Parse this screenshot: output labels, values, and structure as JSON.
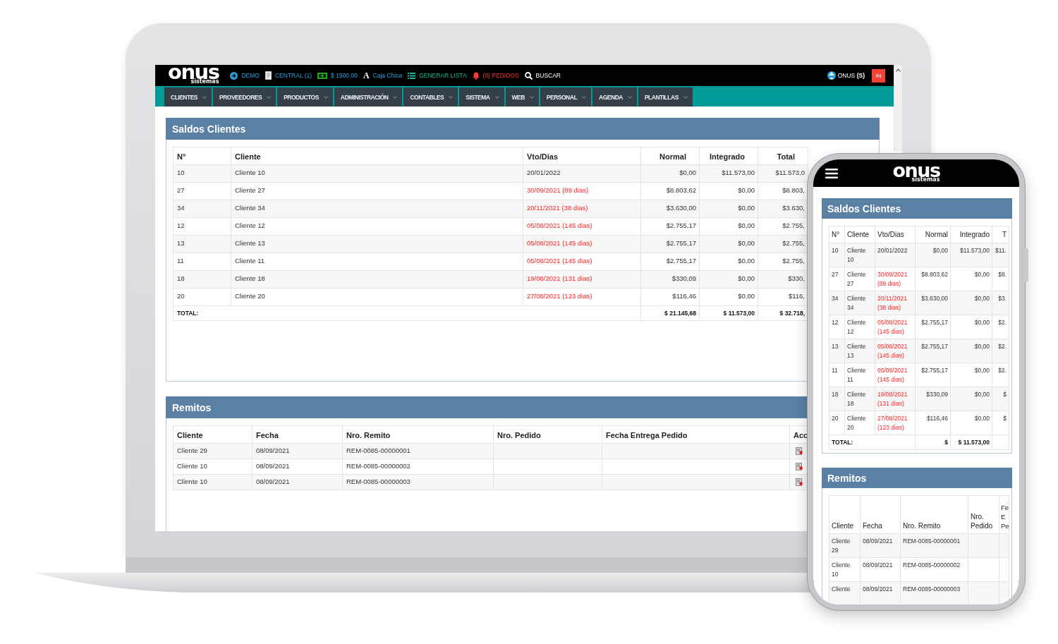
{
  "laptop": {
    "topbar": {
      "logo": {
        "wordmark": "onus",
        "tagline": "sistemas"
      },
      "links": [
        {
          "kind": "demo",
          "label": "DEMO"
        },
        {
          "kind": "branch",
          "label": "CENTRAL (1)"
        },
        {
          "kind": "cash",
          "label": "$ 1500.00"
        },
        {
          "kind": "register",
          "icon": "A",
          "label": "Caja Chica"
        },
        {
          "kind": "list",
          "label": "GENERAR LISTA"
        },
        {
          "kind": "orders",
          "label": "(0) PEDIDOS"
        },
        {
          "kind": "search",
          "label": "BUSCAR"
        }
      ],
      "user": "ONUS **(S)**",
      "badge": "IN"
    },
    "nav": [
      "CLIENTES",
      "PROVEEDORES",
      "PRODUCTOS",
      "ADMINISTRACIÓN",
      "CONTABLES",
      "SISTEMA",
      "WEB",
      "PERSONAL",
      "AGENDA",
      "PLANTILLAS"
    ],
    "panels": [
      {
        "title": "Saldos Clientes",
        "columns": [
          {
            "label": "N°",
            "kind": "text"
          },
          {
            "label": "Cliente",
            "kind": "text"
          },
          {
            "label": "Vto/Dias",
            "kind": "due"
          },
          {
            "label": "Normal",
            "kind": "amount"
          },
          {
            "label": "Integrado",
            "kind": "amount"
          },
          {
            "label": "Total",
            "kind": "amount"
          }
        ],
        "rows": [
          {
            "cells": [
              "10",
              "Cliente 10",
              "20/01/2022",
              "$0,00",
              "$11.573,00",
              "$11.573,0"
            ],
            "overdue": false
          },
          {
            "cells": [
              "27",
              "Cliente 27",
              "30/09/2021 (89 dias)",
              "$8.803,62",
              "$0,00",
              "$8.803,"
            ],
            "overdue": true
          },
          {
            "cells": [
              "34",
              "Cliente 34",
              "20/11/2021 (38 dias)",
              "$3.630,00",
              "$0,00",
              "$3.630,"
            ],
            "overdue": true
          },
          {
            "cells": [
              "12",
              "Cliente 12",
              "05/08/2021 (145 dias)",
              "$2.755,17",
              "$0,00",
              "$2.755,"
            ],
            "overdue": true
          },
          {
            "cells": [
              "13",
              "Cliente 13",
              "05/08/2021 (145 dias)",
              "$2.755,17",
              "$0,00",
              "$2.755,"
            ],
            "overdue": true
          },
          {
            "cells": [
              "11",
              "Cliente 11",
              "05/08/2021 (145 dias)",
              "$2.755,17",
              "$0,00",
              "$2.755,"
            ],
            "overdue": true
          },
          {
            "cells": [
              "18",
              "Cliente 18",
              "19/08/2021 (131 dias)",
              "$330,09",
              "$0,00",
              "$330,"
            ],
            "overdue": true
          },
          {
            "cells": [
              "20",
              "Cliente 20",
              "27/08/2021 (123 dias)",
              "$116,46",
              "$0,00",
              "$116,"
            ],
            "overdue": true
          }
        ],
        "total": {
          "label": "TOTAL:",
          "values": [
            "$ 21.145,68",
            "$ 11.573,00",
            "$ 32.718,"
          ]
        }
      },
      {
        "title": "Remitos",
        "columns": [
          {
            "label": "Cliente",
            "kind": "text"
          },
          {
            "label": "Fecha",
            "kind": "text"
          },
          {
            "label": "Nro. Remito",
            "kind": "text"
          },
          {
            "label": "Nro. Pedido",
            "kind": "text"
          },
          {
            "label": "Fecha Entrega Pedido",
            "kind": "text"
          },
          {
            "label": "Acc",
            "kind": "actions"
          }
        ],
        "rows": [
          {
            "cells": [
              "Cliente 29",
              "08/09/2021",
              "REM-0085-00000001"
            ]
          },
          {
            "cells": [
              "Cliente 10",
              "08/09/2021",
              "REM-0085-00000002"
            ]
          },
          {
            "cells": [
              "Cliente 10",
              "08/09/2021",
              "REM-0085-00000003"
            ]
          }
        ]
      }
    ]
  },
  "phone": {
    "logo": {
      "wordmark": "onus",
      "tagline": "sistemas"
    },
    "panels": [
      {
        "title": "Saldos Clientes",
        "columns": [
          {
            "label": "N°",
            "kind": "text"
          },
          {
            "label": "Cliente",
            "kind": "text"
          },
          {
            "label": "Vto/Dias",
            "kind": "due"
          },
          {
            "label": "Normal",
            "kind": "amount"
          },
          {
            "label": "Integrado",
            "kind": "amount"
          },
          {
            "label": "T",
            "kind": "amount"
          }
        ],
        "rows": [
          {
            "cells": [
              "10",
              "Cliente 10",
              "20/01/2022",
              "$0,00",
              "$11.573,00",
              "$11."
            ],
            "overdue": false
          },
          {
            "cells": [
              "27",
              "Cliente 27",
              "30/09/2021 (89 dias)",
              "$8.803,62",
              "$0,00",
              "$8."
            ],
            "overdue": true
          },
          {
            "cells": [
              "34",
              "Cliente 34",
              "20/11/2021 (38 dias)",
              "$3.630,00",
              "$0,00",
              "$3."
            ],
            "overdue": true
          },
          {
            "cells": [
              "12",
              "Cliente 12",
              "05/08/2021 (145 dias)",
              "$2.755,17",
              "$0,00",
              "$2."
            ],
            "overdue": true
          },
          {
            "cells": [
              "13",
              "Cliente 13",
              "05/08/2021 (145 dias)",
              "$2.755,17",
              "$0,00",
              "$2."
            ],
            "overdue": true
          },
          {
            "cells": [
              "11",
              "Cliente 11",
              "05/08/2021 (145 dias)",
              "$2.755,17",
              "$0,00",
              "$2."
            ],
            "overdue": true
          },
          {
            "cells": [
              "18",
              "Cliente 18",
              "19/08/2021 (131 dias)",
              "$330,09",
              "$0,00",
              "$"
            ],
            "overdue": true
          },
          {
            "cells": [
              "20",
              "Cliente 20",
              "27/08/2021 (123 dias)",
              "$116,46",
              "$0,00",
              "$"
            ],
            "overdue": true
          }
        ],
        "total": {
          "label": "TOTAL:",
          "values": [
            "$",
            "$ 11.573,00"
          ]
        }
      },
      {
        "title": "Remitos",
        "columns": [
          {
            "label": "Cliente",
            "kind": "text"
          },
          {
            "label": "Fecha",
            "kind": "text"
          },
          {
            "label": "Nro. Remito",
            "kind": "text"
          },
          {
            "label": "Nro. Pedido",
            "kind": "text"
          },
          {
            "label": "Fe E Pe",
            "kind": "text"
          }
        ],
        "rows": [
          {
            "cells": [
              "Cliente 29",
              "08/09/2021",
              "REM-0085-00000001"
            ]
          },
          {
            "cells": [
              "Cliente 10",
              "08/09/2021",
              "REM-0085-00000002"
            ]
          },
          {
            "cells": [
              "Cliente",
              "08/09/2021",
              "REM-0085-00000003"
            ]
          }
        ]
      }
    ]
  }
}
